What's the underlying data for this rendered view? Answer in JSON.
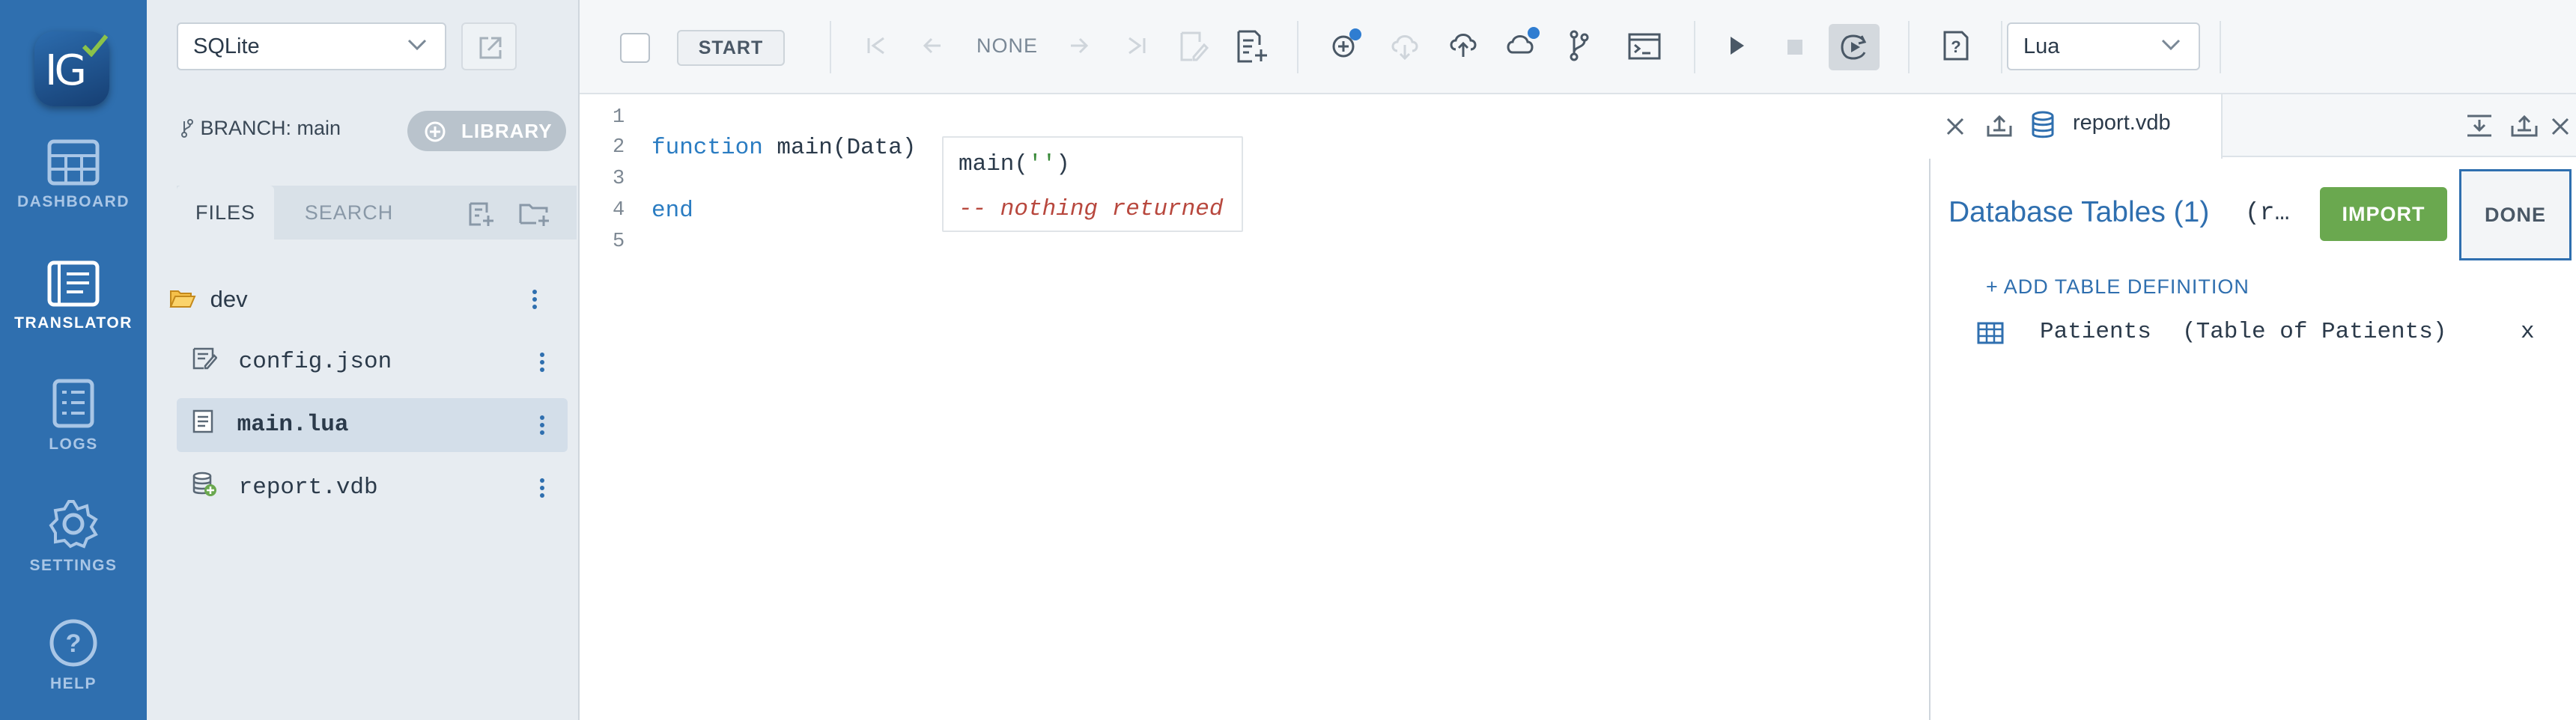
{
  "nav": {
    "logo": "IG",
    "items": [
      {
        "label": "DASHBOARD",
        "icon": "dashboard-icon"
      },
      {
        "label": "TRANSLATOR",
        "icon": "translator-icon",
        "active": true
      },
      {
        "label": "LOGS",
        "icon": "logs-icon"
      },
      {
        "label": "SETTINGS",
        "icon": "gear-icon"
      },
      {
        "label": "HELP",
        "icon": "help-icon"
      }
    ]
  },
  "files": {
    "db_select": "SQLite",
    "branch_label": "BRANCH:",
    "branch_name": "main",
    "library_label": "LIBRARY",
    "tabs": [
      "FILES",
      "SEARCH"
    ],
    "tree": [
      {
        "name": "dev",
        "icon": "folder-open-icon"
      },
      {
        "name": "config.json",
        "icon": "json-file-icon"
      },
      {
        "name": "main.lua",
        "icon": "lua-file-icon",
        "selected": true
      },
      {
        "name": "report.vdb",
        "icon": "database-file-icon"
      }
    ]
  },
  "toolbar": {
    "start_label": "START",
    "sample_label": "NONE",
    "language": "Lua"
  },
  "editor": {
    "line_numbers": [
      "1",
      "2",
      "3",
      "4",
      "5"
    ],
    "line2_keyword": "function",
    "line2_rest": " main(Data)",
    "line4_keyword": "end",
    "annotation_call_prefix": "main(",
    "annotation_call_arg": "''",
    "annotation_call_suffix": ")",
    "annotation_result": "-- nothing returned"
  },
  "right": {
    "tab_file": "report.vdb",
    "title": "Database Tables (1)",
    "subtitle": "(r…",
    "import_label": "IMPORT",
    "done_label": "DONE",
    "add_table_label": "+ ADD TABLE DEFINITION",
    "tables": [
      {
        "name": "Patients",
        "description": "(Table of Patients)",
        "remove": "x"
      }
    ]
  },
  "colors": {
    "nav_bg": "#2f6faf",
    "accent_blue": "#2f6faf",
    "import_green": "#6aa84f",
    "keyword": "#2a7cc2",
    "comment": "#b8483e"
  }
}
